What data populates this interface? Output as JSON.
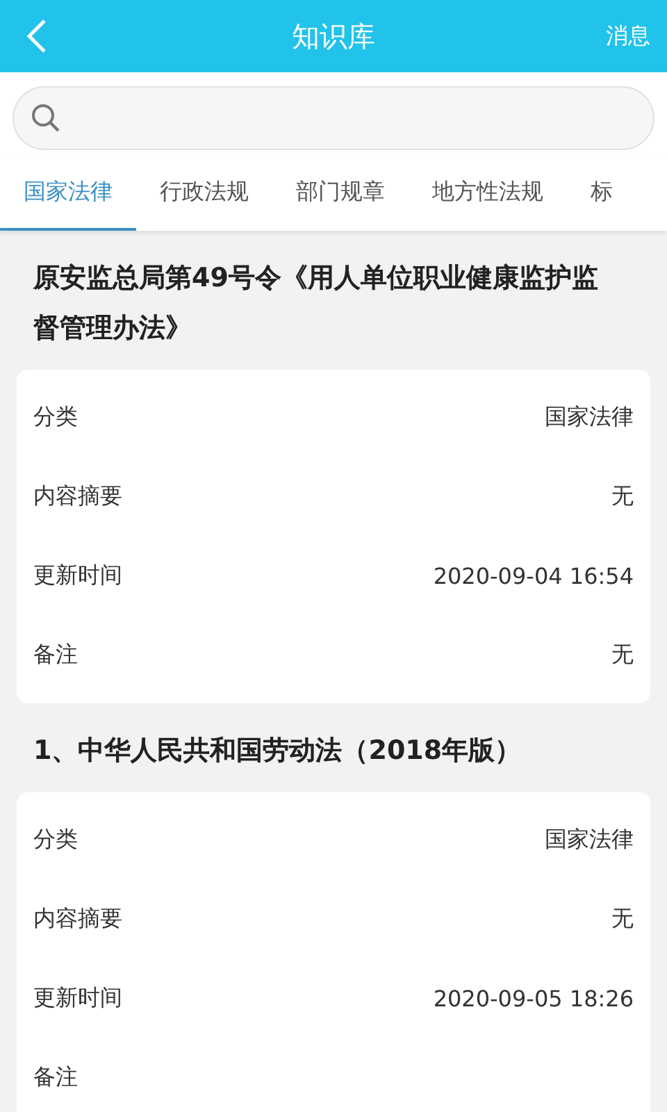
{
  "header": {
    "title": "知识库",
    "action": "消息"
  },
  "tabs": [
    {
      "label": "国家法律",
      "selected": true
    },
    {
      "label": "行政法规",
      "selected": false
    },
    {
      "label": "部门规章",
      "selected": false
    },
    {
      "label": "地方性法规",
      "selected": false
    },
    {
      "label": "标",
      "selected": false
    }
  ],
  "documents": [
    {
      "title": "原安监总局第49号令《用人单位职业健康监护监督管理办法》",
      "fields": [
        {
          "label": "分类",
          "value": "国家法律"
        },
        {
          "label": "内容摘要",
          "value": "无"
        },
        {
          "label": "更新时间",
          "value": "2020-09-04 16:54"
        },
        {
          "label": "备注",
          "value": "无"
        }
      ]
    },
    {
      "title": "1、中华人民共和国劳动法（2018年版）",
      "fields": [
        {
          "label": "分类",
          "value": "国家法律"
        },
        {
          "label": "内容摘要",
          "value": "无"
        },
        {
          "label": "更新时间",
          "value": "2020-09-05 18:26"
        },
        {
          "label": "备注"
        }
      ]
    }
  ]
}
